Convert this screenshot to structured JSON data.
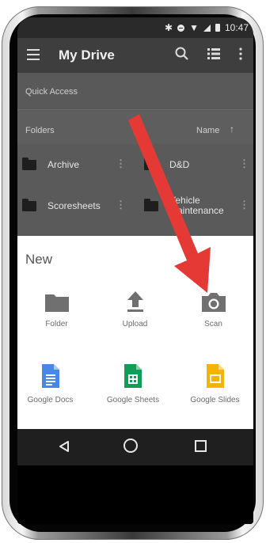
{
  "status": {
    "time": "10:47"
  },
  "appbar": {
    "title": "My Drive"
  },
  "quick_access": {
    "label": "Quick Access"
  },
  "folders_header": {
    "label": "Folders",
    "sort_label": "Name",
    "sort_arrow": "↑"
  },
  "folders": [
    {
      "name": "Archive"
    },
    {
      "name": "D&D"
    },
    {
      "name": "Scoresheets"
    },
    {
      "name": "Vehicle Maintenance"
    }
  ],
  "new_sheet": {
    "title": "New",
    "options": [
      {
        "label": "Folder",
        "icon": "folder-icon",
        "color": "#707070"
      },
      {
        "label": "Upload",
        "icon": "upload-icon",
        "color": "#707070"
      },
      {
        "label": "Scan",
        "icon": "camera-icon",
        "color": "#707070"
      },
      {
        "label": "Google Docs",
        "icon": "google-docs-icon",
        "color": "#4a86e8"
      },
      {
        "label": "Google Sheets",
        "icon": "google-sheets-icon",
        "color": "#0f9d58"
      },
      {
        "label": "Google Slides",
        "icon": "google-slides-icon",
        "color": "#f4b400"
      }
    ]
  },
  "annotation": {
    "arrow_color": "#e53935"
  }
}
